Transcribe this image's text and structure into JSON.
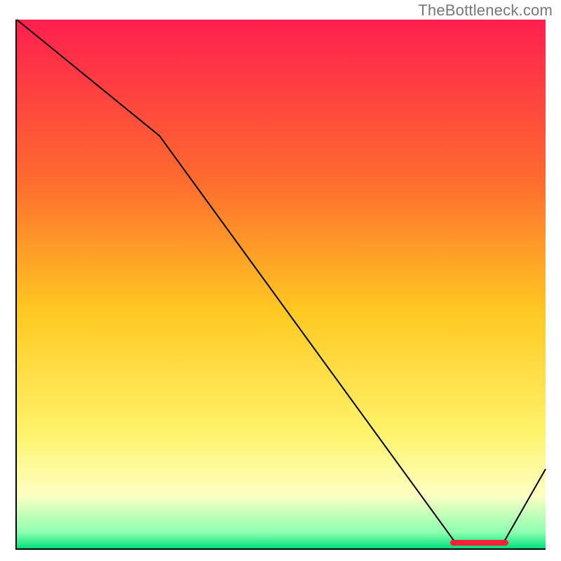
{
  "watermark": "TheBottleneck.com",
  "chart_data": {
    "type": "line",
    "title": "",
    "xlabel": "",
    "ylabel": "",
    "xlim": [
      0,
      100
    ],
    "ylim": [
      0,
      100
    ],
    "series": [
      {
        "name": "curve",
        "x": [
          0,
          27,
          83,
          92,
          100
        ],
        "values": [
          100,
          78,
          1,
          1,
          15
        ]
      }
    ],
    "gradient_stops": [
      {
        "pct": 0,
        "color": "#ff1f4f"
      },
      {
        "pct": 30,
        "color": "#ff6a2f"
      },
      {
        "pct": 55,
        "color": "#ffc821"
      },
      {
        "pct": 78,
        "color": "#fff36a"
      },
      {
        "pct": 90,
        "color": "#fdffc3"
      },
      {
        "pct": 97,
        "color": "#8cffb0"
      },
      {
        "pct": 100,
        "color": "#00e07a"
      }
    ],
    "marker": {
      "x_start": 82,
      "x_end": 93,
      "y": 1,
      "color": "#ff1f3a"
    }
  }
}
